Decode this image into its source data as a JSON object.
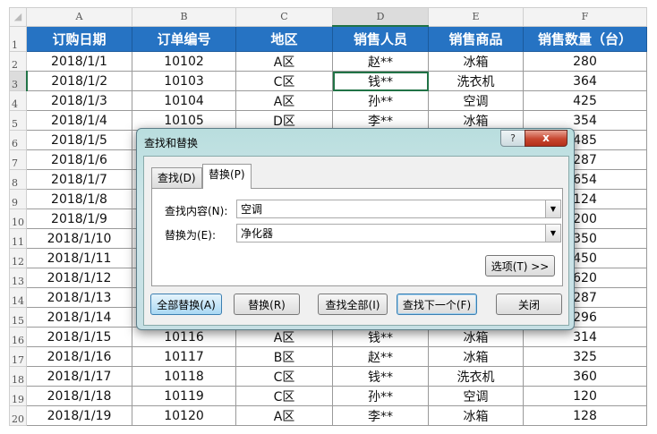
{
  "columns": [
    "A",
    "B",
    "C",
    "D",
    "E",
    "F"
  ],
  "headers": [
    "订购日期",
    "订单编号",
    "地区",
    "销售人员",
    "销售商品",
    "销售数量（台）"
  ],
  "rows": [
    {
      "n": "2",
      "a": "2018/1/1",
      "b": "10102",
      "c": "A区",
      "d": "赵**",
      "e": "冰箱",
      "f": "280"
    },
    {
      "n": "3",
      "a": "2018/1/2",
      "b": "10103",
      "c": "C区",
      "d": "钱**",
      "e": "洗衣机",
      "f": "364"
    },
    {
      "n": "4",
      "a": "2018/1/3",
      "b": "10104",
      "c": "A区",
      "d": "孙**",
      "e": "空调",
      "f": "425"
    },
    {
      "n": "5",
      "a": "2018/1/4",
      "b": "10105",
      "c": "D区",
      "d": "李**",
      "e": "冰箱",
      "f": "354"
    },
    {
      "n": "6",
      "a": "2018/1/5",
      "b": "",
      "c": "",
      "d": "",
      "e": "",
      "f": "485"
    },
    {
      "n": "7",
      "a": "2018/1/6",
      "b": "",
      "c": "",
      "d": "",
      "e": "",
      "f": "287"
    },
    {
      "n": "8",
      "a": "2018/1/7",
      "b": "",
      "c": "",
      "d": "",
      "e": "",
      "f": "654"
    },
    {
      "n": "9",
      "a": "2018/1/8",
      "b": "",
      "c": "",
      "d": "",
      "e": "",
      "f": "124"
    },
    {
      "n": "10",
      "a": "2018/1/9",
      "b": "",
      "c": "",
      "d": "",
      "e": "",
      "f": "200"
    },
    {
      "n": "11",
      "a": "2018/1/10",
      "b": "",
      "c": "",
      "d": "",
      "e": "",
      "f": "350"
    },
    {
      "n": "12",
      "a": "2018/1/11",
      "b": "",
      "c": "",
      "d": "",
      "e": "",
      "f": "450"
    },
    {
      "n": "13",
      "a": "2018/1/12",
      "b": "",
      "c": "",
      "d": "",
      "e": "",
      "f": "620"
    },
    {
      "n": "14",
      "a": "2018/1/13",
      "b": "",
      "c": "",
      "d": "",
      "e": "",
      "f": "287"
    },
    {
      "n": "15",
      "a": "2018/1/14",
      "b": "",
      "c": "",
      "d": "",
      "e": "",
      "f": "296"
    },
    {
      "n": "16",
      "a": "2018/1/15",
      "b": "10116",
      "c": "A区",
      "d": "钱**",
      "e": "冰箱",
      "f": "314"
    },
    {
      "n": "17",
      "a": "2018/1/16",
      "b": "10117",
      "c": "B区",
      "d": "赵**",
      "e": "冰箱",
      "f": "325"
    },
    {
      "n": "18",
      "a": "2018/1/17",
      "b": "10118",
      "c": "C区",
      "d": "钱**",
      "e": "洗衣机",
      "f": "360"
    },
    {
      "n": "19",
      "a": "2018/1/18",
      "b": "10119",
      "c": "C区",
      "d": "孙**",
      "e": "空调",
      "f": "120"
    },
    {
      "n": "20",
      "a": "2018/1/19",
      "b": "10120",
      "c": "A区",
      "d": "李**",
      "e": "冰箱",
      "f": "128"
    }
  ],
  "dialog": {
    "title": "查找和替换",
    "help": "?",
    "close": "x",
    "tab_find": "查找(D)",
    "tab_replace": "替换(P)",
    "find_label": "查找内容(N):",
    "find_value": "空调",
    "replace_label": "替换为(E):",
    "replace_value": "净化器",
    "options": "选项(T) >>",
    "replace_all": "全部替换(A)",
    "replace": "替换(R)",
    "find_all": "查找全部(I)",
    "find_next": "查找下一个(F)",
    "close_btn": "关闭"
  }
}
